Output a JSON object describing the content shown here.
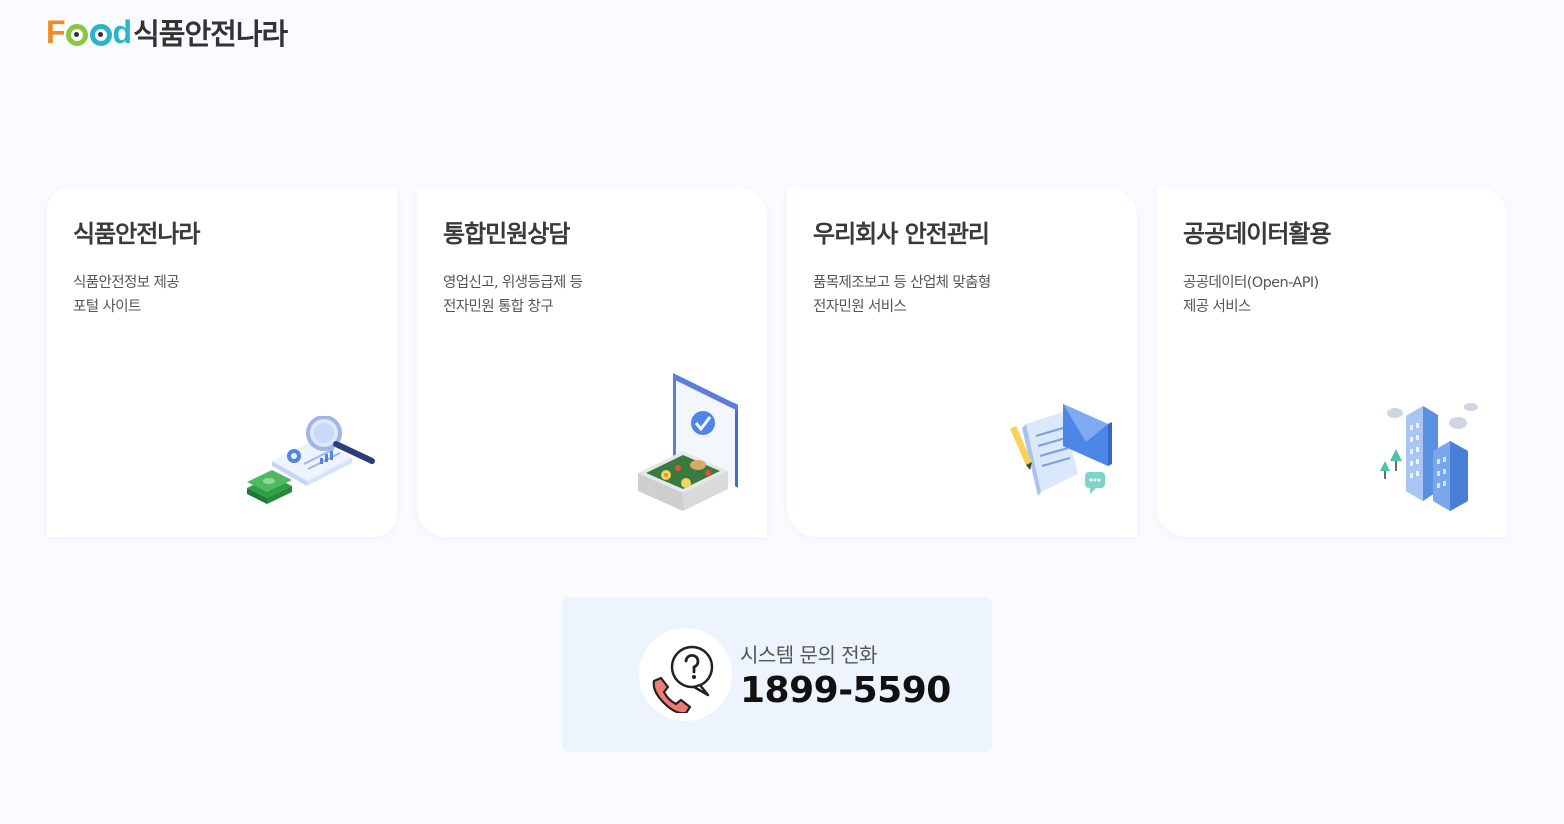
{
  "header": {
    "logo_brand": "Food",
    "logo_title": "식품안전나라"
  },
  "cards": [
    {
      "title": "식품안전나라",
      "desc_line1": "식품안전정보 제공",
      "desc_line2": "포털 사이트",
      "icon": "magnifier-document-icon"
    },
    {
      "title": "통합민원상담",
      "desc_line1": "영업신고, 위생등급제 등",
      "desc_line2": "전자민원 통합 창구",
      "icon": "food-tray-check-icon"
    },
    {
      "title": "우리회사 안전관리",
      "desc_line1": "품목제조보고 등 산업체 맞춤형",
      "desc_line2": "전자민원 서비스",
      "icon": "document-mail-icon"
    },
    {
      "title": "공공데이터활용",
      "desc_line1": "공공데이터(Open-API)",
      "desc_line2": "제공 서비스",
      "icon": "city-buildings-icon"
    }
  ],
  "contact": {
    "label": "시스템 문의 전화",
    "number": "1899-5590",
    "icon": "phone-question-icon"
  },
  "colors": {
    "background": "#f9fbff",
    "card": "#ffffff",
    "contact_bg": "#eef4fe",
    "logo_orange": "#f08a24",
    "logo_green": "#8cc63f",
    "logo_cyan": "#2ab3c9"
  }
}
